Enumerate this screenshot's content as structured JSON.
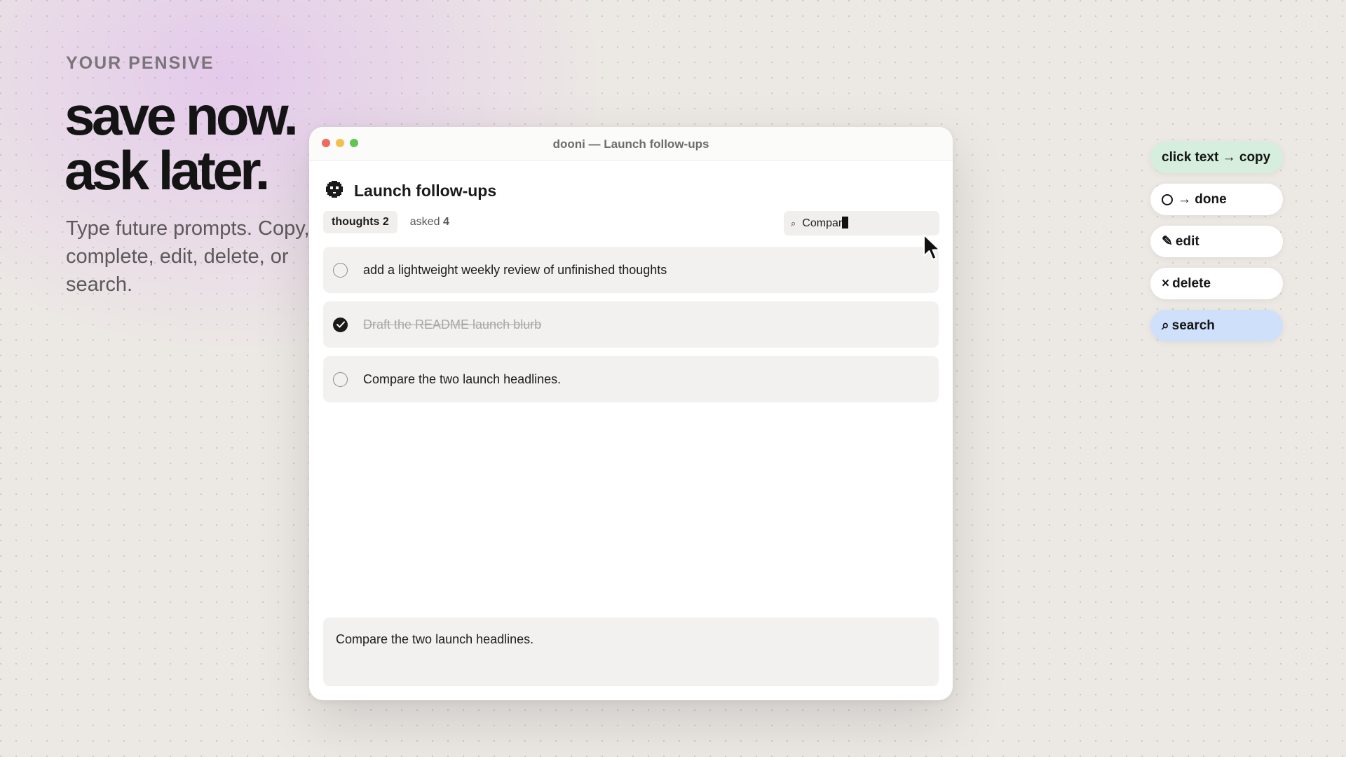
{
  "hero": {
    "eyebrow": "YOUR PENSIVE",
    "headline_line1": "save now.",
    "headline_line2": "ask later.",
    "subcopy": "Type future prompts. Copy, complete, edit, delete, or search."
  },
  "window": {
    "title": "dooni — Launch follow-ups",
    "list_title": "Launch follow-ups",
    "list_icon": "pixel-ghost-icon",
    "tabs": [
      {
        "label": "thoughts",
        "count": "2",
        "active": true
      },
      {
        "label": "asked",
        "count": "4",
        "active": false
      }
    ],
    "search": {
      "icon": "search-icon",
      "value": "Compar"
    },
    "thoughts": [
      {
        "text": "add a lightweight weekly review of unfinished thoughts",
        "done": false
      },
      {
        "text": "Draft the README launch blurb",
        "done": true
      },
      {
        "text": "Compare the two launch headlines.",
        "done": false
      }
    ],
    "composer_text": "Compare the two launch headlines."
  },
  "pills": [
    {
      "label": "click text → copy",
      "style": "green"
    },
    {
      "label": "→ done",
      "icon": "circle-icon",
      "style": "white"
    },
    {
      "label": "edit",
      "glyph": "✎",
      "icon": "pencil-icon",
      "style": "white"
    },
    {
      "label": "delete",
      "glyph": "×",
      "icon": "close-icon",
      "style": "white"
    },
    {
      "label": "search",
      "glyph": "⌕",
      "icon": "search-icon",
      "style": "blue"
    }
  ],
  "colors": {
    "accent_green": "#d6eedd",
    "accent_blue": "#cfe0fb",
    "traffic_close": "#ed6a5e",
    "traffic_min": "#f5bf4f",
    "traffic_max": "#61c554"
  }
}
